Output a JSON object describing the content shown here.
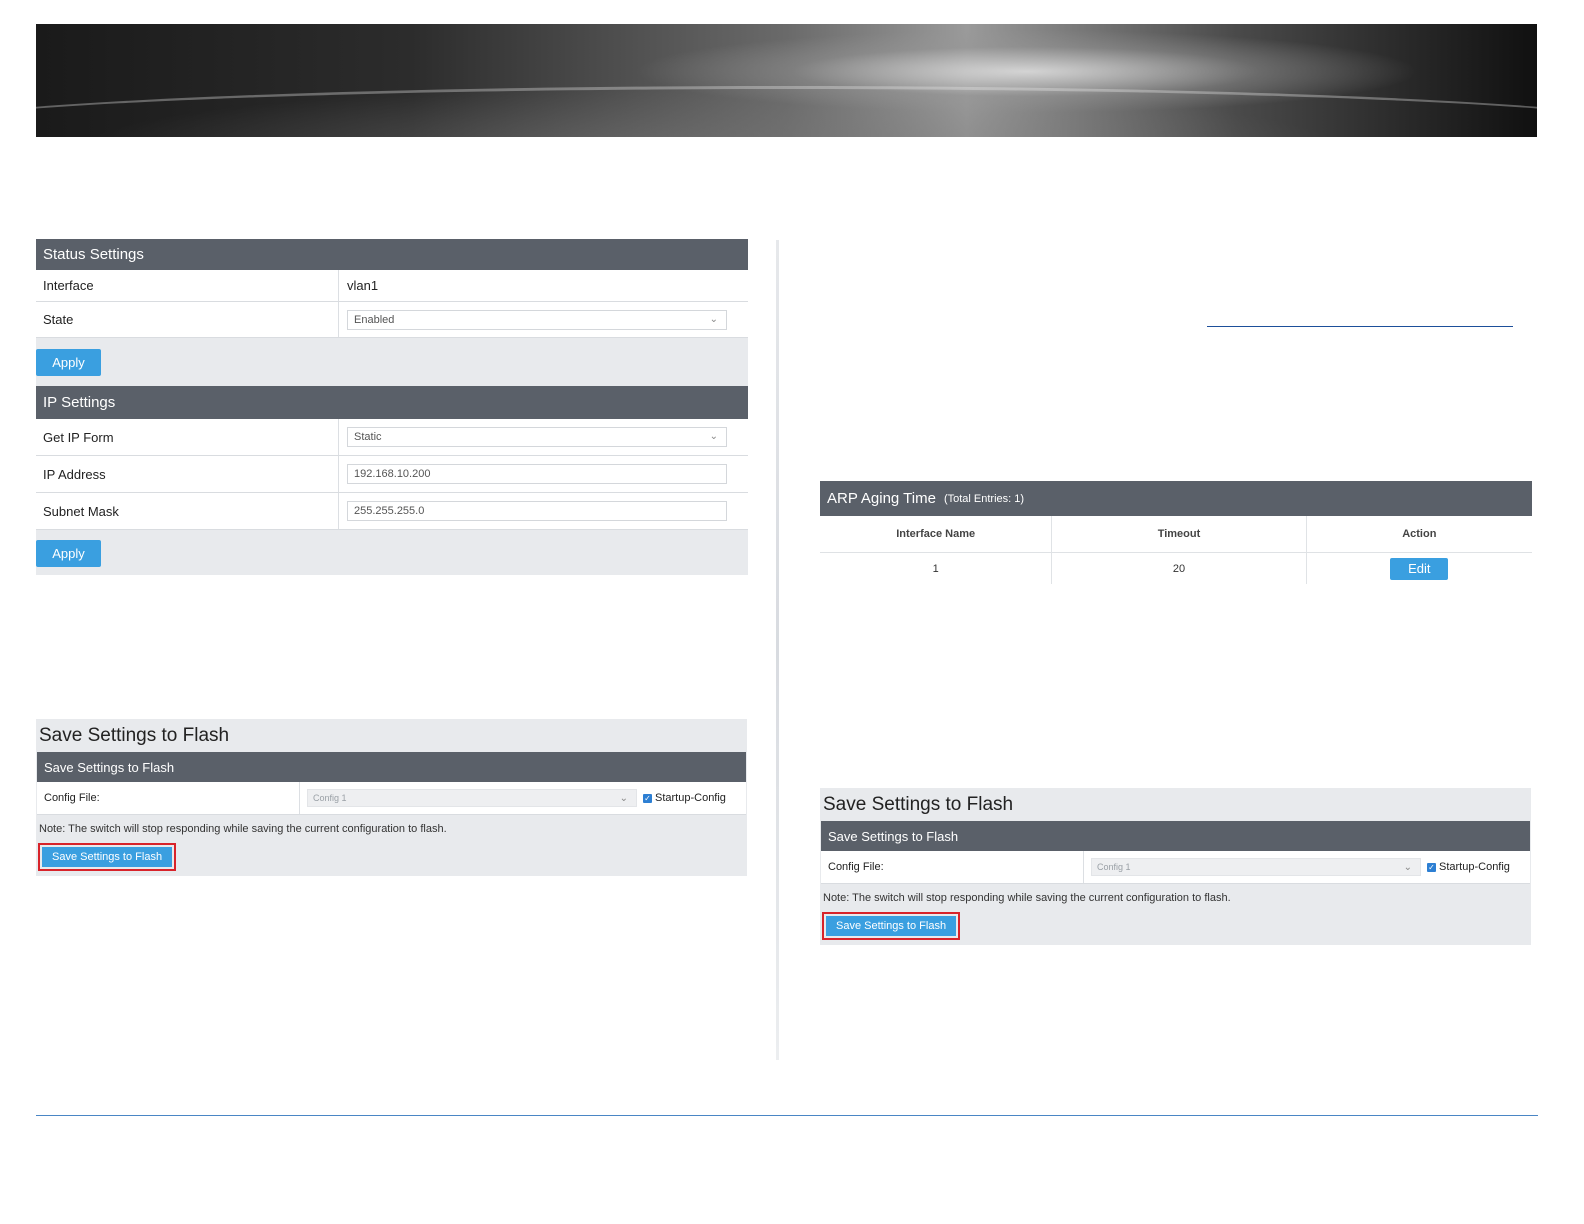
{
  "status_settings": {
    "header": "Status Settings",
    "interface_label": "Interface",
    "interface_value": "vlan1",
    "state_label": "State",
    "state_value": "Enabled",
    "apply_label": "Apply"
  },
  "ip_settings": {
    "header": "IP Settings",
    "get_ip_form_label": "Get IP Form",
    "get_ip_form_value": "Static",
    "ip_address_label": "IP Address",
    "ip_address_value": "192.168.10.200",
    "subnet_mask_label": "Subnet Mask",
    "subnet_mask_value": "255.255.255.0",
    "apply_label": "Apply"
  },
  "flash_left": {
    "title": "Save Settings to Flash",
    "header": "Save Settings to Flash",
    "config_file_label": "Config File:",
    "config_file_value": "Config 1",
    "startup_config_label": "Startup-Config",
    "note": "Note: The switch will stop responding while saving the current configuration to flash.",
    "button_label": "Save Settings to Flash"
  },
  "arp": {
    "title": "ARP Aging Time",
    "subtitle": "(Total Entries: 1)",
    "columns": [
      "Interface Name",
      "Timeout",
      "Action"
    ],
    "rows": [
      {
        "interface": "1",
        "timeout": "20",
        "action": "Edit"
      }
    ]
  },
  "flash_right": {
    "title": "Save Settings to Flash",
    "header": "Save Settings to Flash",
    "config_file_label": "Config File:",
    "config_file_value": "Config 1",
    "startup_config_label": "Startup-Config",
    "note": "Note: The switch will stop responding while saving the current configuration to flash.",
    "button_label": "Save Settings to Flash"
  },
  "colors": {
    "panel_header": "#5a6069",
    "button_blue": "#3a9fe0",
    "highlight_red": "#d8232a",
    "footer_line": "#4a86c5"
  },
  "icons": [
    "chevron-down-icon",
    "checkbox-checked-icon"
  ]
}
